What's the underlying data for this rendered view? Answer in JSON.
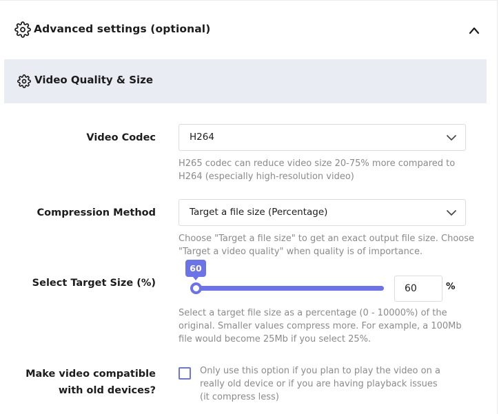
{
  "advanced": {
    "title": "Advanced settings (optional)",
    "icon": "gear-icon",
    "toggle_icon": "chevron-up-icon"
  },
  "section": {
    "title": "Video Quality & Size",
    "icon": "gear-icon"
  },
  "codec": {
    "label": "Video Codec",
    "value": "H264",
    "help": "H265 codec can reduce video size 20-75% more compared to H264 (especially high-resolution video)"
  },
  "compression": {
    "label": "Compression Method",
    "value": "Target a file size (Percentage)",
    "help": "Choose \"Target a file size\" to get an exact output file size. Choose \"Target a video quality\" when quality is of importance."
  },
  "target_size": {
    "label": "Select Target Size (%)",
    "slider_value": "60",
    "input_value": "60",
    "unit": "%",
    "help": "Select a target file size as a percentage (0 - 10000%) of the original. Smaller values compress more. For example, a 100Mb file would become 25Mb if you select 25%."
  },
  "compat": {
    "label_line1": "Make video compatible",
    "label_line2": "with old devices?",
    "checked": false,
    "help": "Only use this option if you plan to play the video on a really old device or if you are having playback issues (it compress less)"
  },
  "colors": {
    "accent": "#6b73e6",
    "section_bg": "#e9ecf2",
    "help_text": "#8a8a8a"
  }
}
